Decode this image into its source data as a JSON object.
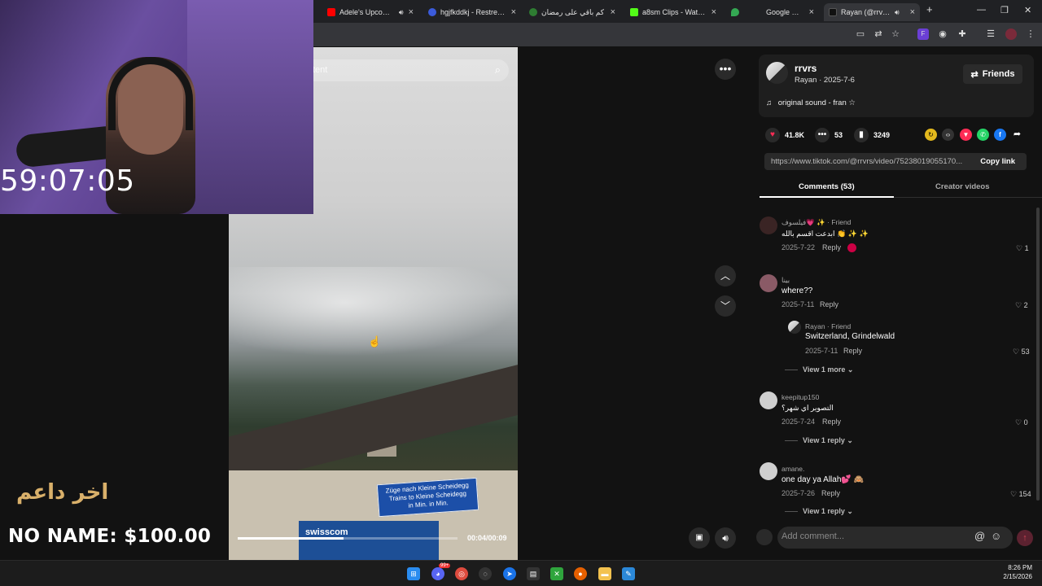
{
  "browser": {
    "tabs": [
      {
        "title": "Adele's Upcoming",
        "color": "#ff0000"
      },
      {
        "title": "hgjfkddkj - Restream",
        "color": "#3b5bdb"
      },
      {
        "title": "كم باقي على رمضان",
        "color": "#2e7d32"
      },
      {
        "title": "a8sm Clips - Watch L",
        "color": "#53fc18"
      },
      {
        "title": "Google خرائط",
        "color": "#34a853"
      },
      {
        "title": "Rayan (@rrvrs) |",
        "color": "#111111"
      }
    ],
    "new_tab": "+",
    "close": "×"
  },
  "video": {
    "search_placeholder": "tent",
    "sign_line1": "Züge nach Kleine Scheidegg",
    "sign_line2": "Trains to Kleine Scheidegg",
    "sign_line3": "in      Min.        in      Min.",
    "billboard": "swisscom",
    "time": "00:04/00:09",
    "progress": 0.48
  },
  "stream": {
    "timer": "59:07:05",
    "arabic_title": "اخر داعم",
    "donation": "NO NAME: $100.00"
  },
  "post": {
    "username": "rrvrs",
    "subline": "Rayan · 2025-7-6",
    "friends_label": "Friends",
    "sound": "original sound - fran ☆",
    "likes": "41.8K",
    "comments": "53",
    "saves": "3249",
    "link": "https://www.tiktok.com/@rrvrs/video/75238019055170...",
    "copy_label": "Copy link",
    "tab_comments": "Comments (53)",
    "tab_creator": "Creator videos"
  },
  "comments": [
    {
      "name": "فيلسوف💗 ✨ · Friend",
      "text": "ابدعت اقسم بالله 👏 ✨ ✨",
      "date": "2025-7-22",
      "reply": "Reply",
      "likes": "1"
    },
    {
      "name": "بينا",
      "text": "where??",
      "date": "2025-7-11",
      "reply": "Reply",
      "likes": "2"
    },
    {
      "name": "Rayan · Friend",
      "text": "Switzerland, Grindelwald",
      "date": "2025-7-11",
      "reply": "Reply",
      "likes": "53"
    },
    {
      "name": "keepitup150",
      "text": "التصوير اي شهر؟",
      "date": "2025-7-24",
      "reply": "Reply",
      "likes": "0"
    },
    {
      "name": "amane.",
      "text": "one day ya Allah💕 🙈",
      "date": "2025-7-26",
      "reply": "Reply",
      "likes": "154"
    }
  ],
  "view_more": {
    "first": "View 1 more",
    "second": "View 1 reply",
    "third": "View 1 reply"
  },
  "composer": {
    "placeholder": "Add comment...",
    "at": "@",
    "emoji": "☺"
  },
  "taskbar": {
    "time": "8:26 PM",
    "date": "2/15/2026",
    "discord_badge": "99+"
  },
  "icons": {
    "more": "more-icon",
    "up": "chevron-up-icon",
    "down": "chevron-down-icon",
    "volume": "volume-icon"
  }
}
